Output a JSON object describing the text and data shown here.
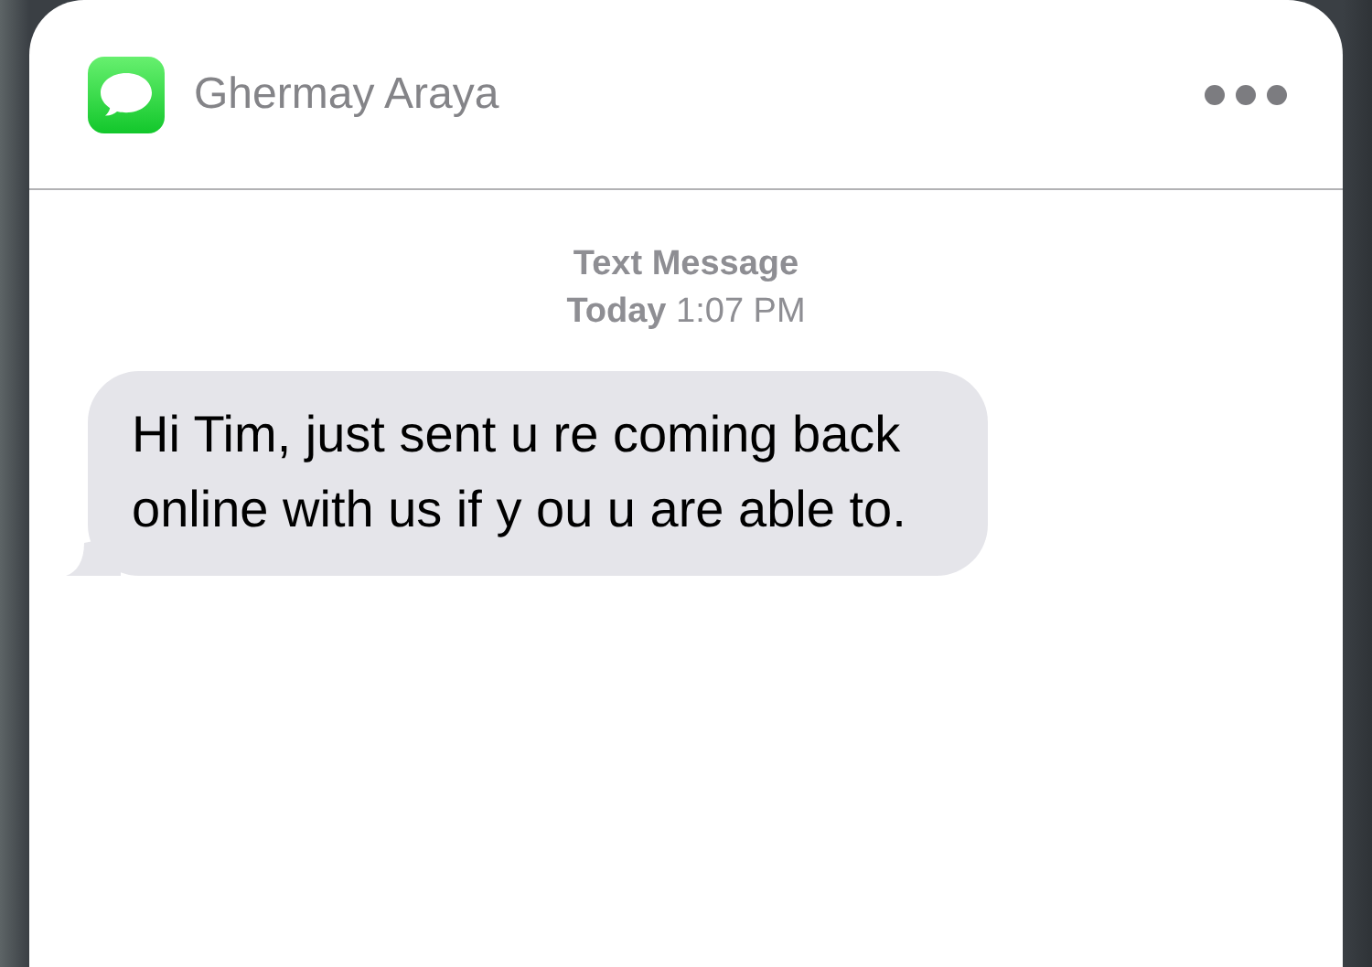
{
  "notification": {
    "title": "Ghermay Araya"
  },
  "conversation": {
    "service": "Text Message",
    "timestamp": "**Today** 1:07 PM"
  },
  "messages": [
    {
      "kind": "incoming",
      "text": "Hi Tim, just sent u re coming back online with us if y ou u are able to."
    }
  ]
}
